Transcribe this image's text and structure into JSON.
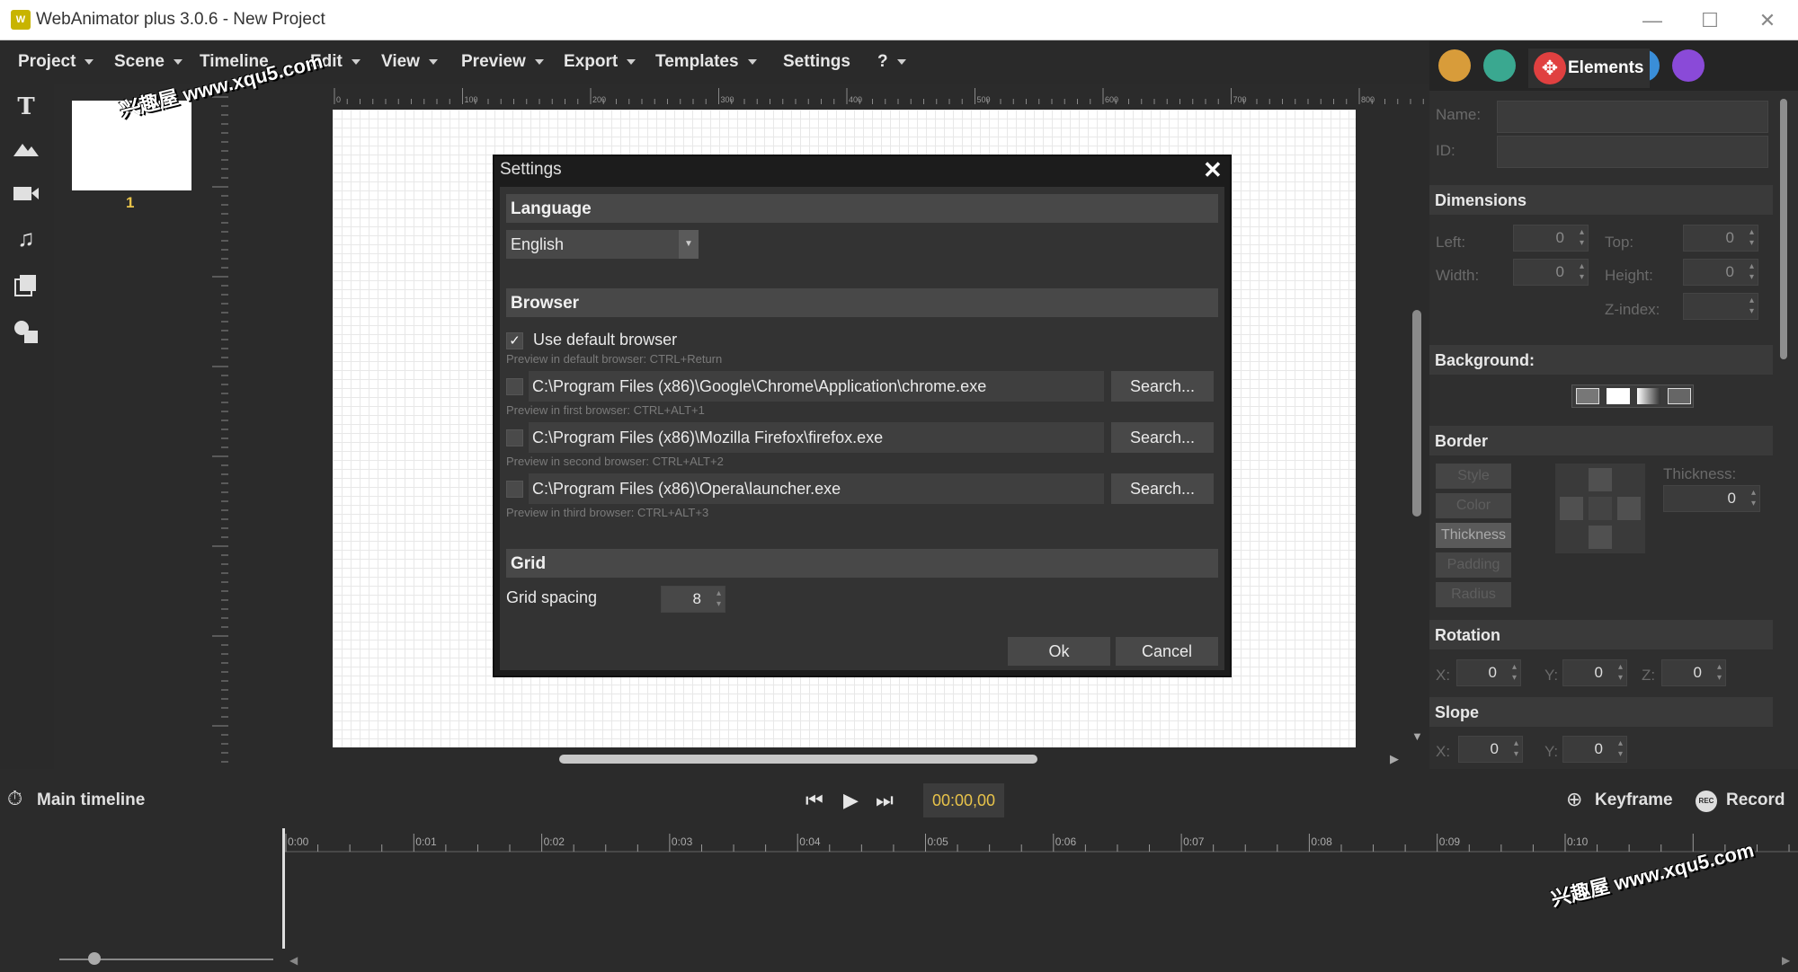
{
  "window": {
    "title": "WebAnimator plus 3.0.6 - New Project",
    "icon_text": "W",
    "minimize": "—",
    "maximize": "☐",
    "close": "✕"
  },
  "menu": [
    {
      "label": "Project"
    },
    {
      "label": "Scene"
    },
    {
      "label": "Timeline"
    },
    {
      "label": "Edit"
    },
    {
      "label": "View"
    },
    {
      "label": "Preview"
    },
    {
      "label": "Export"
    },
    {
      "label": "Templates"
    },
    {
      "label": "Settings"
    },
    {
      "label": "?"
    }
  ],
  "scenes": [
    {
      "number": "1"
    }
  ],
  "right_panel": {
    "active_tab": "Elements",
    "name_label": "Name:",
    "id_label": "ID:",
    "dimensions": {
      "header": "Dimensions",
      "left_label": "Left:",
      "left_value": "0",
      "top_label": "Top:",
      "top_value": "0",
      "width_label": "Width:",
      "width_value": "0",
      "height_label": "Height:",
      "height_value": "0",
      "zindex_label": "Z-index:",
      "zindex_value": ""
    },
    "background": {
      "header": "Background:"
    },
    "border": {
      "header": "Border",
      "buttons": [
        "Style",
        "Color",
        "Thickness",
        "Padding",
        "Radius"
      ],
      "thickness_label": "Thickness:",
      "thickness_value": "0"
    },
    "rotation": {
      "header": "Rotation",
      "x_label": "X:",
      "x_value": "0",
      "y_label": "Y:",
      "y_value": "0",
      "z_label": "Z:",
      "z_value": "0"
    },
    "slope": {
      "header": "Slope",
      "x_label": "X:",
      "x_value": "0",
      "y_label": "Y:",
      "y_value": "0"
    }
  },
  "timeline": {
    "title": "Main timeline",
    "time": "00:00,00",
    "keyframe_label": "Keyframe",
    "record_label": "Record",
    "ticks": [
      "0:00",
      "0:01",
      "0:02",
      "0:03",
      "0:04",
      "0:05",
      "0:06",
      "0:07",
      "0:08",
      "0:09",
      "0:10"
    ]
  },
  "ruler": {
    "h_ticks": [
      "0",
      "100",
      "200",
      "300",
      "400",
      "500",
      "600",
      "700",
      "800"
    ]
  },
  "dialog": {
    "title": "Settings",
    "close": "✕",
    "language_header": "Language",
    "language_value": "English",
    "browser_header": "Browser",
    "default_browser_label": "Use default browser",
    "default_browser_checked": true,
    "default_browser_hint": "Preview in default browser: CTRL+Return",
    "browsers": [
      {
        "path": "C:\\Program Files (x86)\\Google\\Chrome\\Application\\chrome.exe",
        "hint": "Preview in first browser: CTRL+ALT+1",
        "button": "Search..."
      },
      {
        "path": "C:\\Program Files (x86)\\Mozilla Firefox\\firefox.exe",
        "hint": "Preview in second browser: CTRL+ALT+2",
        "button": "Search..."
      },
      {
        "path": "C:\\Program Files (x86)\\Opera\\launcher.exe",
        "hint": "Preview in third browser: CTRL+ALT+3",
        "button": "Search..."
      }
    ],
    "grid_header": "Grid",
    "grid_spacing_label": "Grid spacing",
    "grid_spacing_value": "8",
    "ok_label": "Ok",
    "cancel_label": "Cancel"
  },
  "watermarks": [
    "兴趣屋 www.xqu5.com",
    "兴趣屋 www.xqu5.com"
  ]
}
